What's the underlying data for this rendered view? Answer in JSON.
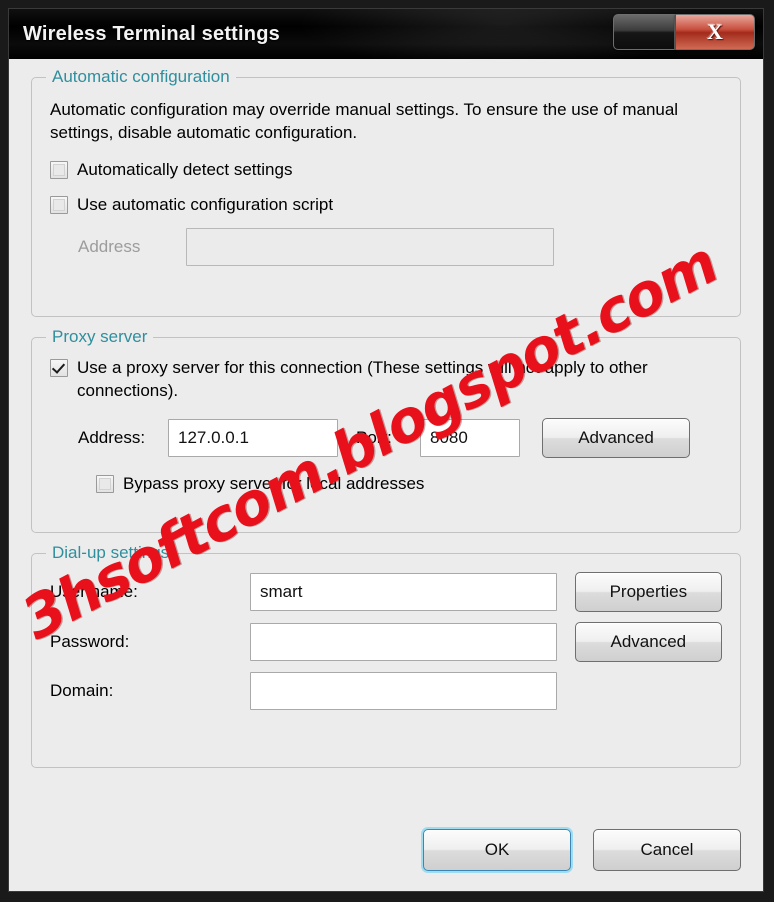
{
  "window": {
    "title": "Wireless Terminal settings",
    "minimize_label": "",
    "close_label": "X"
  },
  "automatic_configuration": {
    "legend": "Automatic configuration",
    "description": "Automatic configuration may override manual settings.  To ensure the use of manual settings, disable automatic configuration.",
    "detect_settings": {
      "label": "Automatically detect settings",
      "checked": false
    },
    "use_script": {
      "label": "Use automatic configuration script",
      "checked": false
    },
    "address": {
      "label": "Address",
      "value": "",
      "disabled": true
    }
  },
  "proxy_server": {
    "legend": "Proxy server",
    "use_proxy": {
      "label": "Use a proxy server for this connection (These settings will not apply to other connections).",
      "checked": true
    },
    "address_label": "Address:",
    "address_value": "127.0.0.1",
    "port_label": "Port:",
    "port_value": "8080",
    "advanced_label": "Advanced",
    "bypass": {
      "label": "Bypass proxy server for local addresses",
      "checked": false
    }
  },
  "dialup_settings": {
    "legend": "Dial-up settings",
    "username_label": "User name:",
    "username_value": "smart",
    "properties_label": "Properties",
    "password_label": "Password:",
    "password_value": "",
    "advanced_label": "Advanced",
    "domain_label": "Domain:",
    "domain_value": ""
  },
  "footer": {
    "ok_label": "OK",
    "cancel_label": "Cancel"
  },
  "watermark": {
    "text": "3hsoftcom.blogspot.com",
    "color": "#e8101a"
  },
  "colors": {
    "legend_teal": "#2f8f9e",
    "dialog_bg": "#ececec",
    "titlebar_bg": "#000000",
    "close_red": "#c9503f",
    "focus_blue": "#9fdcf0"
  }
}
